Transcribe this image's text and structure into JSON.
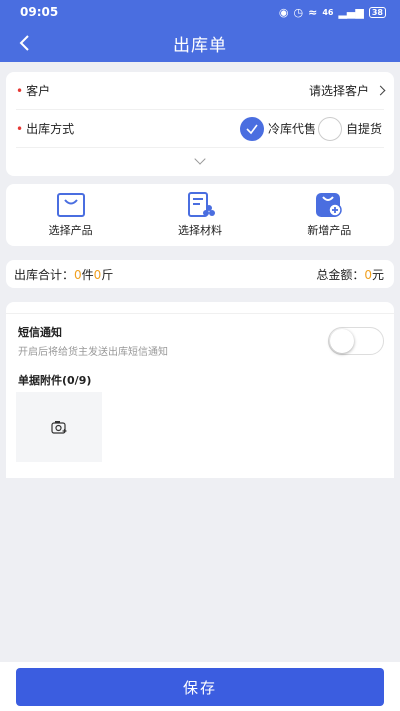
{
  "status_bar": {
    "time": "09:05",
    "network": "46",
    "battery": "38"
  },
  "header": {
    "title": "出库单"
  },
  "form": {
    "customer": {
      "label": "客户",
      "placeholder": "请选择客户"
    },
    "outbound_method": {
      "label": "出库方式",
      "options": [
        {
          "label": "冷库代售",
          "selected": true
        },
        {
          "label": "自提货",
          "selected": false
        }
      ]
    }
  },
  "actions": [
    {
      "label": "选择产品",
      "icon": "shopping-bag-icon"
    },
    {
      "label": "选择材料",
      "icon": "material-list-icon"
    },
    {
      "label": "新增产品",
      "icon": "add-product-icon"
    }
  ],
  "totals": {
    "label": "出库合计：",
    "piece_count": "0",
    "piece_unit": "件",
    "weight": "0",
    "weight_unit": "斤",
    "amount_label": "总金额：",
    "amount": "0",
    "amount_unit": "元"
  },
  "sms": {
    "title": "短信通知",
    "description": "开启后将给货主发送出库短信通知",
    "enabled": false
  },
  "attachments": {
    "title": "单据附件(0/9)"
  },
  "footer": {
    "save_label": "保存"
  },
  "colors": {
    "primary": "#4a6ee0",
    "button": "#3b5de0",
    "required": "#e53935",
    "highlight": "#f0a020"
  }
}
